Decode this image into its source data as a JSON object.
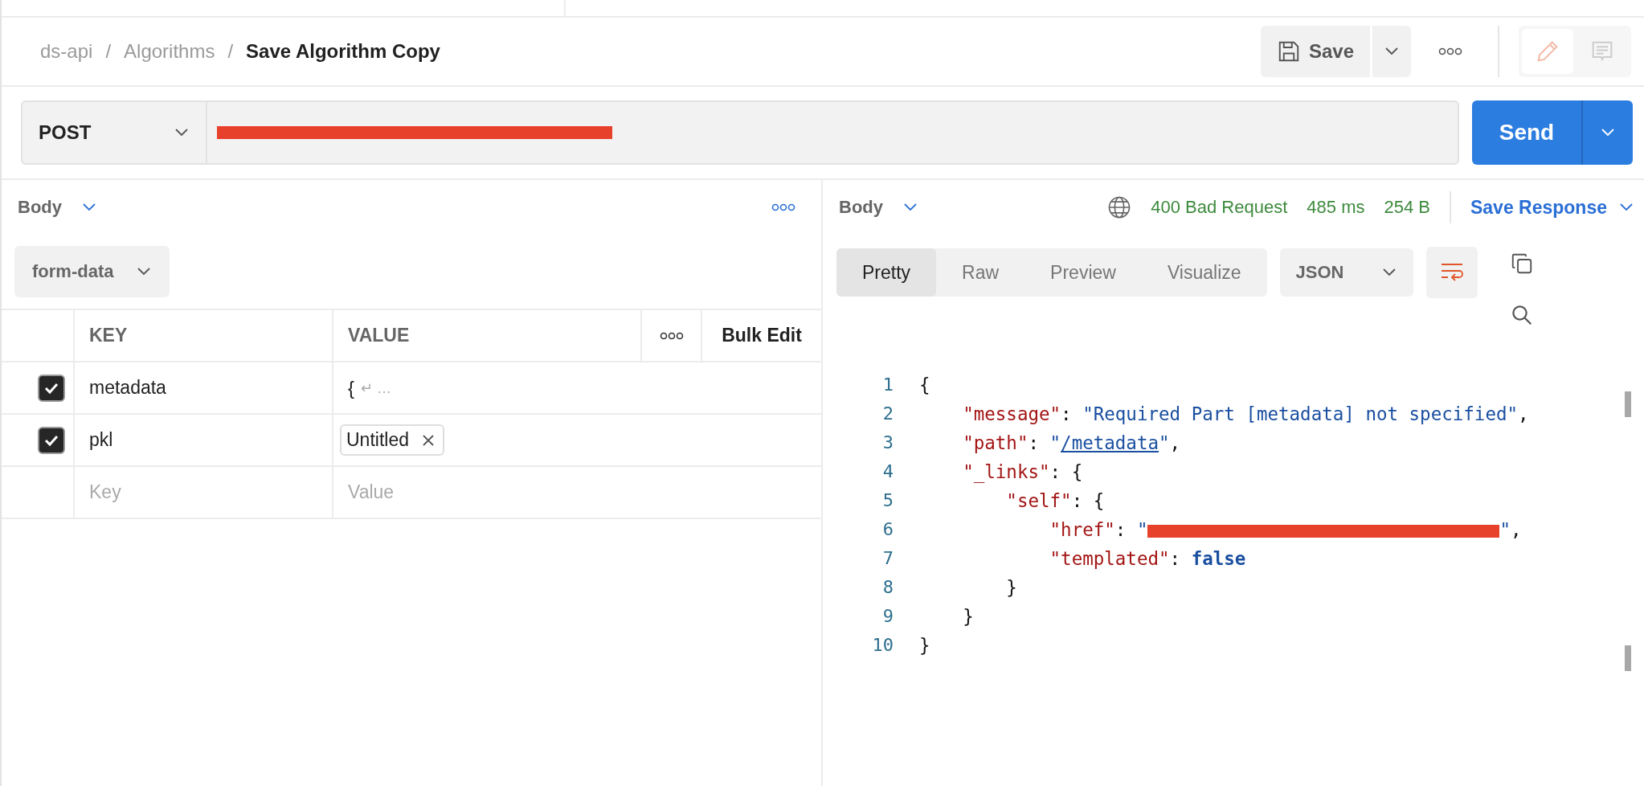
{
  "breadcrumb": [
    {
      "kind": "crumb",
      "text": "ds-api",
      "current": false
    },
    {
      "kind": "separator",
      "text": "/"
    },
    {
      "kind": "crumb",
      "text": "Algorithms",
      "current": false
    },
    {
      "kind": "separator",
      "text": "/"
    },
    {
      "kind": "crumb",
      "text": "Save Algorithm Copy",
      "current": true
    }
  ],
  "toolbar": {
    "save": "Save",
    "modes": [
      {
        "kind": "edit",
        "selected": true
      },
      {
        "kind": "comments",
        "selected": false
      }
    ]
  },
  "request": {
    "method": "POST",
    "url_redacted": true,
    "send": "Send"
  },
  "body_panel": {
    "title": "Body",
    "mode": "form-data",
    "columns": [
      "KEY",
      "VALUE"
    ],
    "bulk_edit": "Bulk Edit",
    "rows": [
      {
        "checked": true,
        "key": "metadata",
        "kind": "text",
        "value": "{",
        "continuation": "↵ …"
      },
      {
        "checked": true,
        "key": "pkl",
        "kind": "file",
        "value": "Untitled"
      }
    ],
    "new_row": {
      "key": {
        "placeholder": "Key"
      },
      "value": {
        "placeholder": "Value"
      }
    }
  },
  "response": {
    "title": "Body",
    "status": "400 Bad Request",
    "time": "485 ms",
    "size": "254 B",
    "save_response": "Save Response",
    "views": [
      {
        "label": "Pretty",
        "selected": true
      },
      {
        "label": "Raw",
        "selected": false
      },
      {
        "label": "Preview",
        "selected": false
      },
      {
        "label": "Visualize",
        "selected": false
      }
    ],
    "format": "JSON",
    "wrap_lines": true,
    "code_lines": [
      {
        "number": "1",
        "tokens": [
          {
            "kind": "punct",
            "text": "{"
          }
        ]
      },
      {
        "number": "2",
        "tokens": [
          {
            "kind": "key",
            "text": "\"message\""
          },
          {
            "kind": "punct",
            "text": ": "
          },
          {
            "kind": "string",
            "text": "\"Required Part [metadata] not specified\""
          },
          {
            "kind": "punct",
            "text": ","
          }
        ]
      },
      {
        "number": "3",
        "tokens": [
          {
            "kind": "key",
            "text": "\"path\""
          },
          {
            "kind": "punct",
            "text": ": "
          },
          {
            "kind": "string",
            "text": "\""
          },
          {
            "kind": "link",
            "text": "/metadata"
          },
          {
            "kind": "string",
            "text": "\""
          },
          {
            "kind": "punct",
            "text": ","
          }
        ]
      },
      {
        "number": "4",
        "tokens": [
          {
            "kind": "key",
            "text": "\"_links\""
          },
          {
            "kind": "punct",
            "text": ": {"
          }
        ]
      },
      {
        "number": "5",
        "tokens": [
          {
            "kind": "key",
            "text": "\"self\""
          },
          {
            "kind": "punct",
            "text": ": {"
          }
        ]
      },
      {
        "number": "6",
        "tokens": [
          {
            "kind": "key",
            "text": "\"href\""
          },
          {
            "kind": "punct",
            "text": ": "
          },
          {
            "kind": "string",
            "text": "\""
          },
          {
            "kind": "redacted"
          },
          {
            "kind": "string",
            "text": "\""
          },
          {
            "kind": "punct",
            "text": ","
          }
        ]
      },
      {
        "number": "7",
        "tokens": [
          {
            "kind": "key",
            "text": "\"templated\""
          },
          {
            "kind": "punct",
            "text": ": "
          },
          {
            "kind": "keyword",
            "text": "false"
          }
        ]
      },
      {
        "number": "8",
        "tokens": [
          {
            "kind": "punct",
            "text": "}"
          }
        ]
      },
      {
        "number": "9",
        "tokens": [
          {
            "kind": "punct",
            "text": "}"
          }
        ]
      },
      {
        "number": "10",
        "tokens": [
          {
            "kind": "punct",
            "text": "}"
          }
        ]
      }
    ]
  }
}
